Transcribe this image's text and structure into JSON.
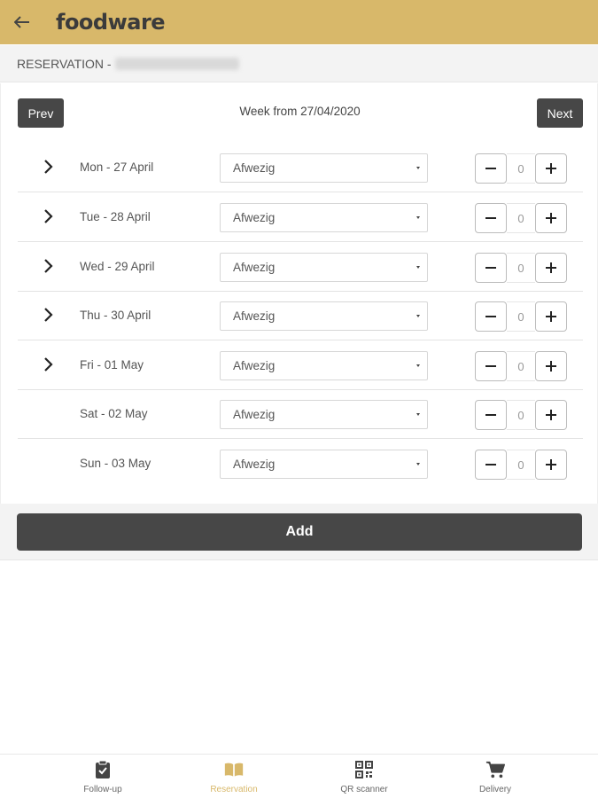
{
  "app": {
    "brand": "foodware"
  },
  "header": {
    "title": "RESERVATION -"
  },
  "week": {
    "label": "Week from 27/04/2020",
    "prev_label": "Prev",
    "next_label": "Next"
  },
  "days": [
    {
      "label": "Mon - 27 April",
      "status": "Afwezig",
      "count": "0",
      "expandable": true
    },
    {
      "label": "Tue - 28 April",
      "status": "Afwezig",
      "count": "0",
      "expandable": true
    },
    {
      "label": "Wed - 29 April",
      "status": "Afwezig",
      "count": "0",
      "expandable": true
    },
    {
      "label": "Thu - 30 April",
      "status": "Afwezig",
      "count": "0",
      "expandable": true
    },
    {
      "label": "Fri - 01 May",
      "status": "Afwezig",
      "count": "0",
      "expandable": true
    },
    {
      "label": "Sat - 02 May",
      "status": "Afwezig",
      "count": "0",
      "expandable": false
    },
    {
      "label": "Sun - 03 May",
      "status": "Afwezig",
      "count": "0",
      "expandable": false
    }
  ],
  "add_label": "Add",
  "bottom_nav": [
    {
      "label": "Follow-up",
      "icon": "clipboard-check-icon",
      "active": false
    },
    {
      "label": "Reservation",
      "icon": "book-open-icon",
      "active": true
    },
    {
      "label": "QR scanner",
      "icon": "qr-code-icon",
      "active": false
    },
    {
      "label": "Delivery",
      "icon": "cart-icon",
      "active": false
    }
  ],
  "colors": {
    "accent": "#d8b86a",
    "button_dark": "#474747"
  }
}
